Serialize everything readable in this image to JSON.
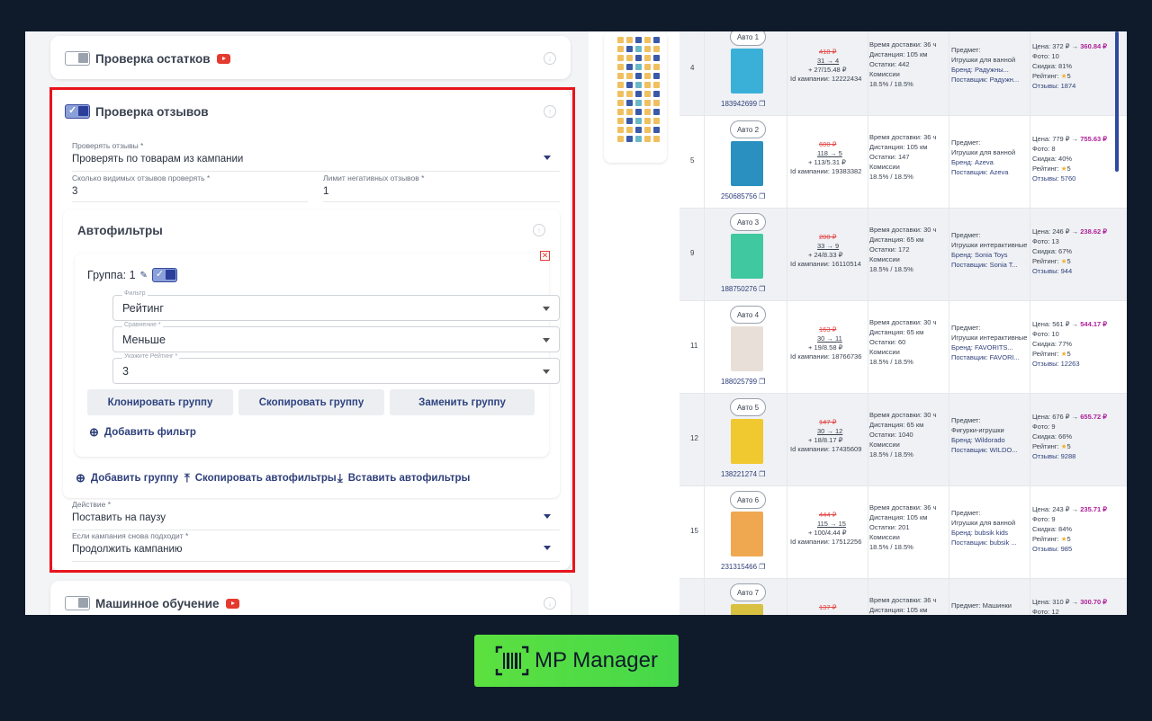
{
  "left": {
    "stock_check": {
      "title": "Проверка остатков"
    },
    "reviews": {
      "title": "Проверка отзывов",
      "check_label": "Проверять отзывы *",
      "check_value": "Проверять по товарам из кампании",
      "visible_label": "Сколько видимых отзывов проверять *",
      "visible_value": "3",
      "limit_label": "Лимит негативных отзывов *",
      "limit_value": "1",
      "autofilters": {
        "title": "Автофильтры",
        "group_label": "Группа: 1",
        "filter_label": "Фильтр",
        "filter_value": "Рейтинг",
        "compare_label": "Сравнение *",
        "compare_value": "Меньше",
        "rating_label": "Укажите Рейтинг *",
        "rating_value": "3",
        "clone": "Клонировать группу",
        "copy": "Скопировать группу",
        "replace": "Заменить группу",
        "add_filter": "Добавить фильтр",
        "add_group": "Добавить группу",
        "copy_af": "Скопировать автофильтры",
        "paste_af": "Вставить автофильтры"
      },
      "action_label": "Действие *",
      "action_value": "Поставить на паузу",
      "fit_label": "Если кампания снова подходит *",
      "fit_value": "Продолжить кампанию"
    },
    "ml": {
      "title": "Машинное обучение"
    }
  },
  "rows": [
    {
      "n": "4",
      "auto": "Авто 1",
      "id": "183942699",
      "p1": "418 ₽",
      "p2": "31 → 4",
      "p3": "+ 27/15.48 ₽",
      "camp": "Id кампании: 12222434",
      "del": "Время доставки: 36 ч",
      "dist": "Дистанция: 105 км",
      "ost": "Остатки: 442",
      "com": "Комиссии",
      "pct": "18.5% / 18.5%",
      "subj": "Предмет:",
      "cat": "Игрушки для ванной",
      "brand": "Бренд: Радужны...",
      "sup": "Поставщик: Радужн...",
      "price": "Цена: 372 ₽ →",
      "pnew": "360.84 ₽",
      "foto": "Фото: 10",
      "disc": "Скидка: 81%",
      "rat": "Рейтинг:",
      "rv": "5",
      "rev": "Отзывы: 1874",
      "col": "#3ab0d8"
    },
    {
      "n": "5",
      "auto": "Авто 2",
      "id": "250685756",
      "p1": "600 ₽",
      "p2": "118 → 5",
      "p3": "+ 113/5.31 ₽",
      "camp": "Id кампании: 19383382",
      "del": "Время доставки: 36 ч",
      "dist": "Дистанция: 105 км",
      "ost": "Остатки: 147",
      "com": "Комиссии",
      "pct": "18.5% / 18.5%",
      "subj": "Предмет:",
      "cat": "Игрушки для ванной",
      "brand": "Бренд: Azeva",
      "sup": "Поставщик: Azeva",
      "price": "Цена: 779 ₽ →",
      "pnew": "755.63 ₽",
      "foto": "Фото: 8",
      "disc": "Скидка: 40%",
      "rat": "Рейтинг:",
      "rv": "5",
      "rev": "Отзывы: 5760",
      "col": "#2a90c0"
    },
    {
      "n": "9",
      "auto": "Авто 3",
      "id": "188750276",
      "p1": "200 ₽",
      "p2": "33 → 9",
      "p3": "+ 24/8.33 ₽",
      "camp": "Id кампании: 16110514",
      "del": "Время доставки: 30 ч",
      "dist": "Дистанция: 65 км",
      "ost": "Остатки: 172",
      "com": "Комиссии",
      "pct": "18.5% / 18.5%",
      "subj": "Предмет:",
      "cat": "Игрушки интерактивные",
      "brand": "Бренд: Sonia Toys",
      "sup": "Поставщик: Sonia T...",
      "price": "Цена: 246 ₽ →",
      "pnew": "238.62 ₽",
      "foto": "Фото: 13",
      "disc": "Скидка: 67%",
      "rat": "Рейтинг:",
      "rv": "5",
      "rev": "Отзывы: 944",
      "col": "#40c8a0"
    },
    {
      "n": "11",
      "auto": "Авто 4",
      "id": "188025799",
      "p1": "163 ₽",
      "p2": "30 → 11",
      "p3": "+ 19/8.58 ₽",
      "camp": "Id кампании: 18766736",
      "del": "Время доставки: 30 ч",
      "dist": "Дистанция: 65 км",
      "ost": "Остатки: 60",
      "com": "Комиссии",
      "pct": "18.5% / 18.5%",
      "subj": "Предмет:",
      "cat": "Игрушки интерактивные",
      "brand": "Бренд: FAVORITS...",
      "sup": "Поставщик: FAVORI...",
      "price": "Цена: 561 ₽ →",
      "pnew": "544.17 ₽",
      "foto": "Фото: 10",
      "disc": "Скидка: 77%",
      "rat": "Рейтинг:",
      "rv": "5",
      "rev": "Отзывы: 12263",
      "col": "#e8e0d8"
    },
    {
      "n": "12",
      "auto": "Авто 5",
      "id": "138221274",
      "p1": "147 ₽",
      "p2": "30 → 12",
      "p3": "+ 18/8.17 ₽",
      "camp": "Id кампании: 17435609",
      "del": "Время доставки: 30 ч",
      "dist": "Дистанция: 65 км",
      "ost": "Остатки: 1040",
      "com": "Комиссии",
      "pct": "18.5% / 18.5%",
      "subj": "Предмет:",
      "cat": "Фигурки-игрушки",
      "brand": "Бренд: Wildorado",
      "sup": "Поставщик: WILDO...",
      "price": "Цена: 676 ₽ →",
      "pnew": "655.72 ₽",
      "foto": "Фото: 9",
      "disc": "Скидка: 66%",
      "rat": "Рейтинг:",
      "rv": "5",
      "rev": "Отзывы: 9288",
      "col": "#f0c830"
    },
    {
      "n": "15",
      "auto": "Авто 6",
      "id": "231315466",
      "p1": "444 ₽",
      "p2": "115 → 15",
      "p3": "+ 100/4.44 ₽",
      "camp": "Id кампании: 17512256",
      "del": "Время доставки: 36 ч",
      "dist": "Дистанция: 105 км",
      "ost": "Остатки: 201",
      "com": "Комиссии",
      "pct": "18.5% / 18.5%",
      "subj": "Предмет:",
      "cat": "Игрушки для ванной",
      "brand": "Бренд: bubsik kids",
      "sup": "Поставщик: bubsik ...",
      "price": "Цена: 243 ₽ →",
      "pnew": "235.71 ₽",
      "foto": "Фото: 9",
      "disc": "Скидка: 84%",
      "rat": "Рейтинг:",
      "rv": "5",
      "rev": "Отзывы: 985",
      "col": "#f0a850"
    },
    {
      "n": "",
      "auto": "Авто 7",
      "id": "",
      "p1": "137 ₽",
      "p2": "",
      "p3": "",
      "camp": "",
      "del": "Время доставки: 36 ч",
      "dist": "Дистанция: 105 км",
      "ost": "",
      "com": "",
      "pct": "",
      "subj": "Предмет: Машинки",
      "cat": "",
      "brand": "",
      "sup": "",
      "price": "Цена: 310 ₽ →",
      "pnew": "300.70 ₽",
      "foto": "Фото: 12",
      "disc": "",
      "rat": "",
      "rv": "",
      "rev": "",
      "col": "#d8c040"
    }
  ],
  "brand": {
    "name": "MP Manager"
  },
  "colors": {
    "accent": "#e8141c",
    "brand_green": "#4ad84a"
  }
}
